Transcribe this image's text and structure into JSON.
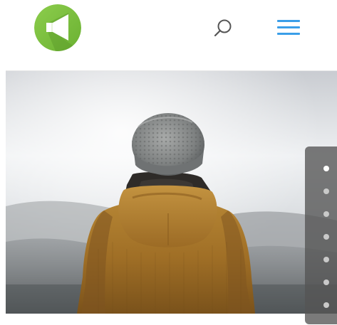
{
  "header": {
    "logo": {
      "icon": "megaphone-icon",
      "color": "#7dc242"
    },
    "search": {
      "icon": "search-icon",
      "color": "#555555"
    },
    "menu": {
      "icon": "hamburger-menu-icon",
      "color": "#3a9ee8"
    }
  },
  "hero": {
    "image": "person-in-beanie-and-hooded-jacket-photo"
  },
  "slider": {
    "total_slides": 7,
    "active_index": 0,
    "dots": [
      {
        "state": "active"
      },
      {
        "state": "inactive"
      },
      {
        "state": "inactive"
      },
      {
        "state": "inactive"
      },
      {
        "state": "inactive"
      },
      {
        "state": "inactive"
      },
      {
        "state": "inactive"
      }
    ]
  }
}
